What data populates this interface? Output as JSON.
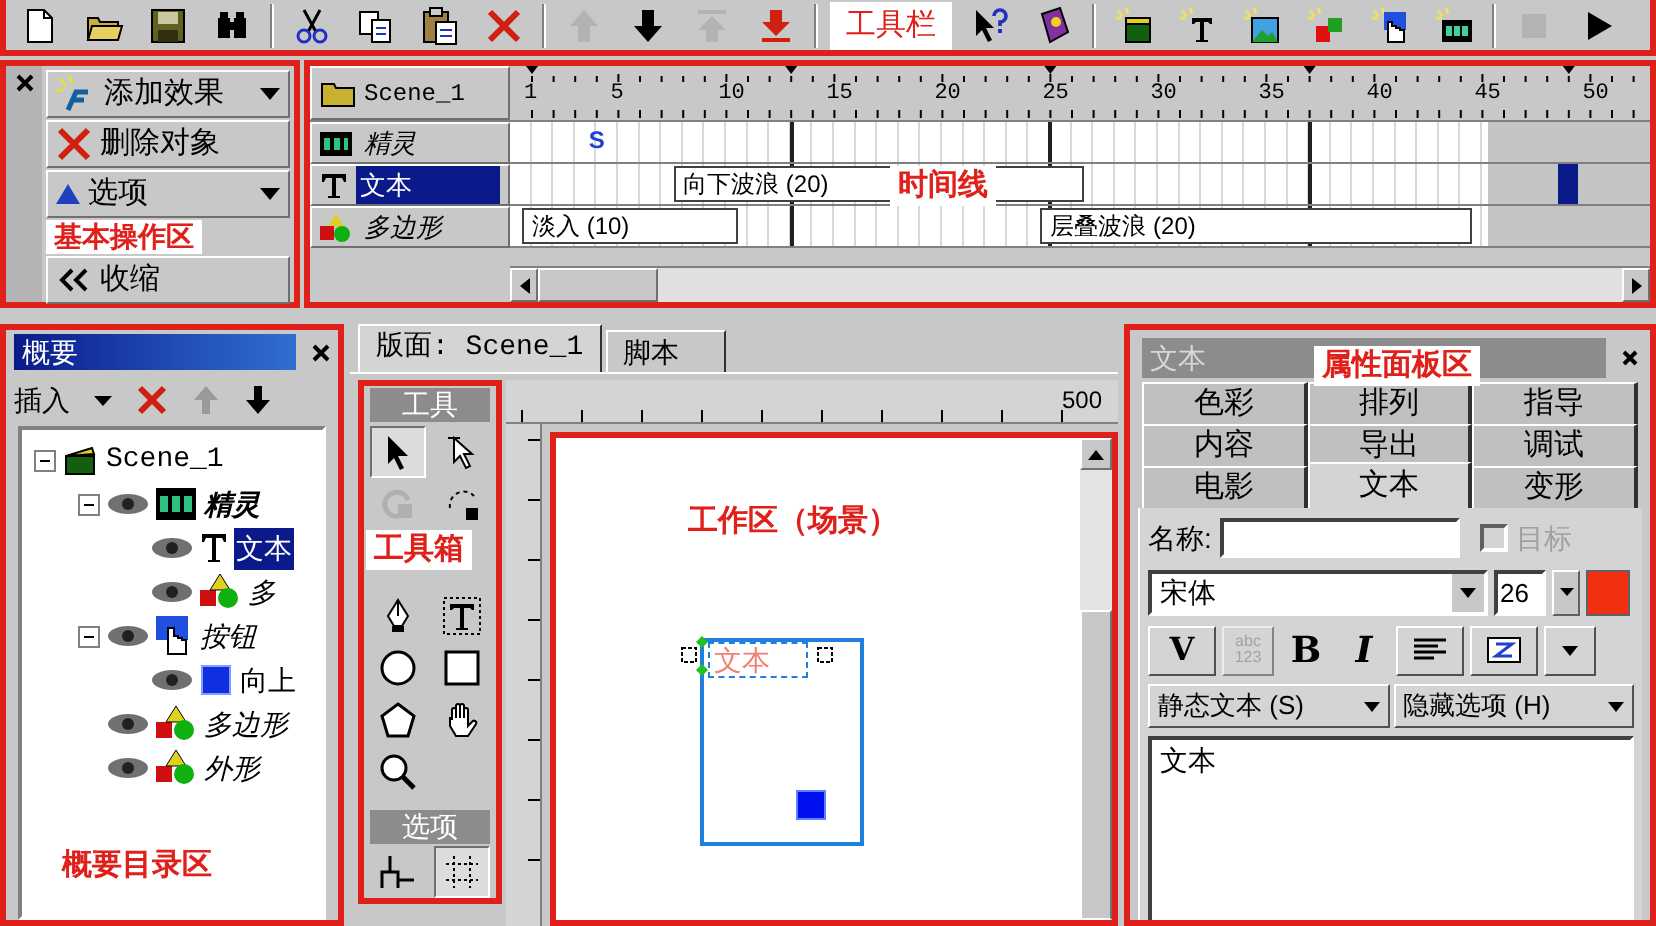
{
  "toolbar": {
    "buttons": [
      {
        "kind": "new",
        "disabled": false
      },
      {
        "kind": "open",
        "disabled": false
      },
      {
        "kind": "save",
        "disabled": false
      },
      {
        "kind": "find",
        "disabled": false
      },
      {
        "kind": "cut",
        "disabled": false
      },
      {
        "kind": "copy",
        "disabled": false
      },
      {
        "kind": "paste",
        "disabled": false
      },
      {
        "kind": "delete",
        "disabled": false
      },
      {
        "kind": "up",
        "disabled": true
      },
      {
        "kind": "down",
        "disabled": false
      },
      {
        "kind": "top",
        "disabled": true
      },
      {
        "kind": "bottom",
        "disabled": false
      },
      {
        "kind": "help",
        "disabled": false
      },
      {
        "kind": "book",
        "disabled": false
      },
      {
        "kind": "scene",
        "disabled": false
      },
      {
        "kind": "text",
        "disabled": false
      },
      {
        "kind": "image",
        "disabled": false
      },
      {
        "kind": "shape",
        "disabled": false
      },
      {
        "kind": "button",
        "disabled": false
      },
      {
        "kind": "sprite",
        "disabled": false
      },
      {
        "kind": "stop",
        "disabled": true
      },
      {
        "kind": "play",
        "disabled": false
      }
    ]
  },
  "actions": [
    {
      "kind": "add",
      "label": "添加效果"
    },
    {
      "kind": "delete",
      "label": "删除对象"
    },
    {
      "kind": "options",
      "label": "选项"
    },
    {
      "kind": "collapse",
      "label": "收缩"
    }
  ],
  "timeline": {
    "scene": "Scene_1",
    "ruler": [
      "1",
      "5",
      "10",
      "15",
      "20",
      "25",
      "30",
      "35",
      "40",
      "45",
      "50"
    ],
    "layers": [
      {
        "kind": "sprite",
        "label": "精灵",
        "selected": false,
        "marker": "S"
      },
      {
        "kind": "text",
        "label": "文本",
        "selected": true,
        "effects": [
          {
            "label": "向下波浪 (20)"
          }
        ]
      },
      {
        "kind": "shape",
        "label": "多边形",
        "selected": false,
        "effects": [
          {
            "label": "淡入 (10)"
          },
          {
            "label": "层叠波浪 (20)"
          }
        ]
      }
    ]
  },
  "outline": {
    "title": "概要",
    "insert": "插入",
    "tree": [
      {
        "kind": "scene",
        "label": "Scene_1",
        "selected": false,
        "expanded": true,
        "children": [
          {
            "kind": "sprite",
            "label": "精灵",
            "selected": false,
            "expanded": true,
            "children": [
              {
                "kind": "text",
                "label": "文本",
                "selected": true
              },
              {
                "kind": "shape",
                "label": "多",
                "selected": false
              }
            ]
          },
          {
            "kind": "button",
            "label": "按钮",
            "selected": false,
            "expanded": true,
            "children": [
              {
                "kind": "image",
                "label": "向上",
                "selected": false
              }
            ]
          },
          {
            "kind": "shape",
            "label": "多边形",
            "selected": false
          },
          {
            "kind": "shape",
            "label": "外形",
            "selected": false
          }
        ]
      }
    ]
  },
  "stage": {
    "tabs": [
      {
        "label": "版面: Scene_1",
        "selected": true
      },
      {
        "label": "脚本",
        "selected": false
      }
    ],
    "ruler_label": "500",
    "scene_text": "文本"
  },
  "toolbox": {
    "title": "工具",
    "options_title": "选项",
    "tools": [
      {
        "kind": "select",
        "selected": true,
        "disabled": false
      },
      {
        "kind": "subselect",
        "selected": false,
        "disabled": false
      },
      {
        "kind": "rotate",
        "selected": false,
        "disabled": true
      },
      {
        "kind": "scale",
        "selected": false,
        "disabled": false
      },
      {
        "kind": "pen",
        "selected": false,
        "disabled": false
      },
      {
        "kind": "textbox",
        "selected": false,
        "disabled": false
      },
      {
        "kind": "ellipse",
        "selected": false,
        "disabled": false
      },
      {
        "kind": "rect",
        "selected": false,
        "disabled": false
      },
      {
        "kind": "polygon",
        "selected": false,
        "disabled": false
      },
      {
        "kind": "hand",
        "selected": false,
        "disabled": false
      },
      {
        "kind": "zoom",
        "selected": false,
        "disabled": false
      }
    ],
    "options": [
      {
        "kind": "snap",
        "selected": false
      },
      {
        "kind": "grid",
        "selected": true
      }
    ]
  },
  "properties": {
    "title": "文本",
    "tab_rows": [
      [
        {
          "label": "色彩",
          "selected": false
        },
        {
          "label": "排列",
          "selected": false
        },
        {
          "label": "指导",
          "selected": false
        }
      ],
      [
        {
          "label": "内容",
          "selected": false
        },
        {
          "label": "导出",
          "selected": false
        },
        {
          "label": "调试",
          "selected": false
        }
      ],
      [
        {
          "label": "电影",
          "selected": false
        },
        {
          "label": "文本",
          "selected": true
        },
        {
          "label": "变形",
          "selected": false
        }
      ]
    ],
    "name_label": "名称:",
    "target": {
      "label": "目标",
      "checked": false,
      "disabled": true
    },
    "font": "宋体",
    "size": "26",
    "color": "#f03010",
    "format_buttons": [
      {
        "kind": "kerning",
        "label": "V",
        "disabled": false
      },
      {
        "kind": "abc",
        "label": "abc 123",
        "disabled": true
      },
      {
        "kind": "bold",
        "label": "B",
        "disabled": false
      },
      {
        "kind": "italic",
        "label": "I",
        "disabled": false
      },
      {
        "kind": "align",
        "disabled": false
      },
      {
        "kind": "z",
        "disabled": false
      },
      {
        "kind": "more",
        "disabled": false
      }
    ],
    "text_type": "静态文本 (S)",
    "hide_options": "隐藏选项 (H)",
    "content": "文本"
  },
  "annotations": [
    "工具栏",
    "基本操作区",
    "时间线",
    "概要目录区",
    "工具箱",
    "工作区（场景）",
    "属性面板区"
  ]
}
